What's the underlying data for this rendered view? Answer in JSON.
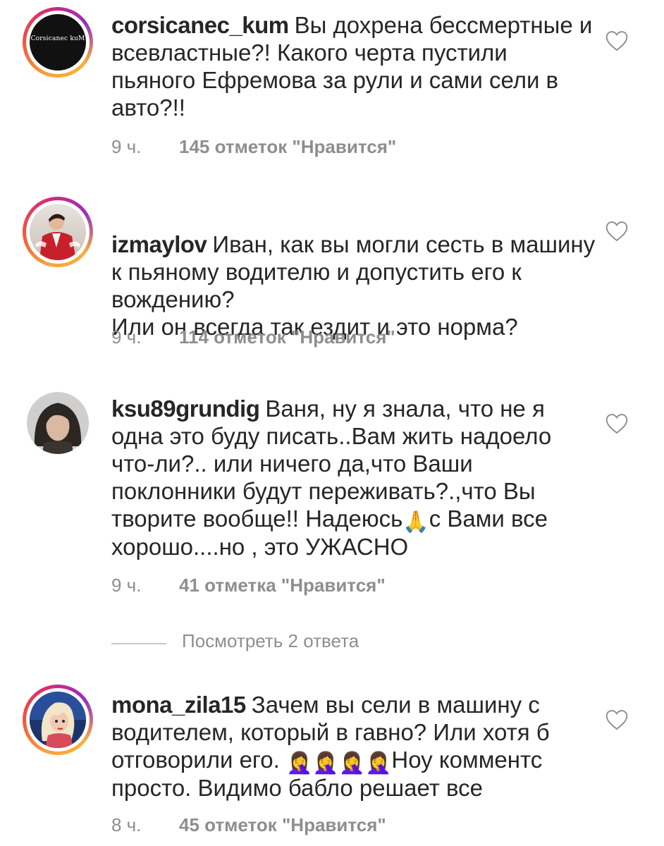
{
  "comments": [
    {
      "username": "corsicanec_kum",
      "text": "Вы дохрена бессмертные и всевластные?! Какого черта пустили пьяного Ефремова за рули и сами сели в авто?!!",
      "time": "9 ч.",
      "likes": "145 отметок \"Нравится\"",
      "avatar_label": "Corsicanec kuM"
    },
    {
      "username": "izmaylov",
      "text": "Иван, как вы могли сесть в машину к пьяному водителю и допустить его к вождению?\nИли он всегда так ездит и это норма?",
      "time": "9 ч.",
      "likes": "114 отметок \"Нравится\""
    },
    {
      "username": "ksu89grundig",
      "text_part1": "Ваня, ну я знала, что не я одна это буду писать..Вам жить надоело что-ли?.. или ничего да,что Ваши поклонники будут переживать?.,что Вы творите вообще!! Надеюсь",
      "emoji": "🙏",
      "text_part2": "с Вами все хорошо....но , это УЖАСНО",
      "time": "9 ч.",
      "likes": "41 отметка \"Нравится\"",
      "replies": "Посмотреть 2 ответа"
    },
    {
      "username": "mona_zila15",
      "text_part1": "Зачем вы сели в машину с водителем, который в гавно? Или хотя б отговорили его.",
      "emoji": "🤦‍♀️🤦‍♀️🤦‍♀️🤦‍♀️",
      "text_part2": "Ноу комментс просто. Видимо бабло решает все",
      "time": "8 ч.",
      "likes": "45 отметок \"Нравится\""
    }
  ],
  "colors": {
    "text": "#262626",
    "meta": "#8e8e8e",
    "heart": "#8e8e8e"
  },
  "icons": [
    "heart-outline-icon"
  ]
}
